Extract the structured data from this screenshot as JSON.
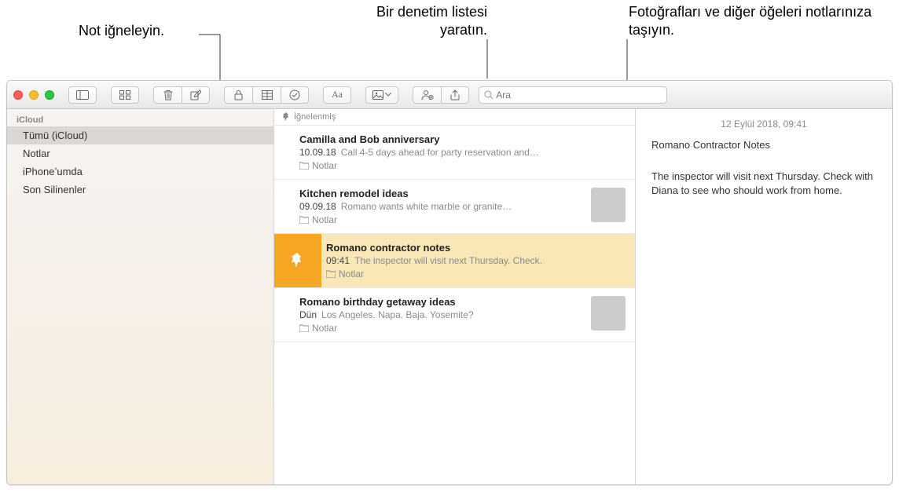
{
  "callouts": {
    "pin": "Not iğneleyin.",
    "checklist": "Bir denetim listesi yaratın.",
    "media": "Fotoğrafları ve diğer öğeleri notlarınıza taşıyın."
  },
  "toolbar": {
    "search_placeholder": "Ara"
  },
  "sidebar": {
    "section": "iCloud",
    "items": [
      {
        "label": "Tümü (iCloud)",
        "selected": true
      },
      {
        "label": "Notlar",
        "selected": false
      },
      {
        "label": "iPhoneʼumda",
        "selected": false
      },
      {
        "label": "Son Silinenler",
        "selected": false
      }
    ]
  },
  "notelist": {
    "pinned_label": "İğnelenmiş",
    "notes": [
      {
        "title": "Camilla and Bob anniversary",
        "date": "10.09.18",
        "preview": "Call 4-5 days ahead for party reservation and…",
        "folder": "Notlar",
        "thumb": null,
        "selected": false
      },
      {
        "title": "Kitchen remodel ideas",
        "date": "09.09.18",
        "preview": "Romano wants white marble or granite…",
        "folder": "Notlar",
        "thumb": "wood",
        "selected": false
      },
      {
        "title": "Romano contractor notes",
        "date": "09:41",
        "preview": "The inspector will visit next Thursday. Check.",
        "folder": "Notlar",
        "thumb": null,
        "selected": true
      },
      {
        "title": "Romano birthday getaway ideas",
        "date": "Dün",
        "preview": "Los Angeles. Napa. Baja. Yosemite?",
        "folder": "Notlar",
        "thumb": "rocks",
        "selected": false
      }
    ]
  },
  "editor": {
    "timestamp": "12 Eylül 2018, 09:41",
    "title": "Romano Contractor Notes",
    "body": "The inspector will visit next Thursday. Check with Diana to see who should work from home."
  }
}
